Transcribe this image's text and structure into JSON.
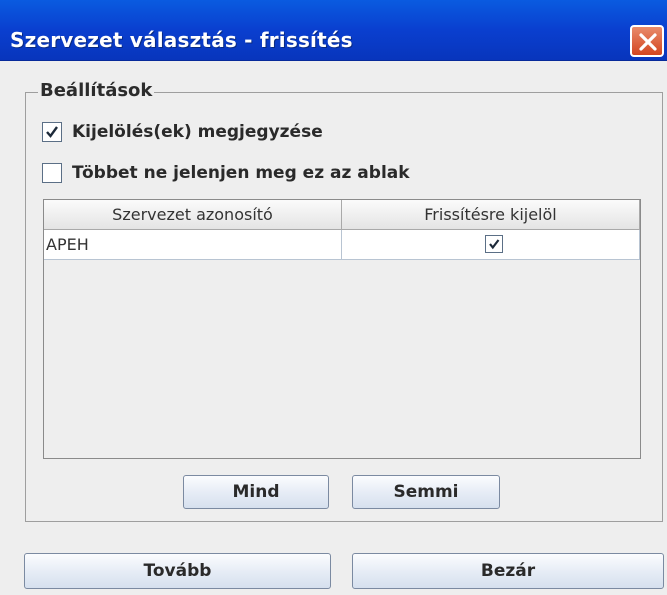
{
  "window": {
    "title": "Szervezet választás - frissítés",
    "close_icon": "close-icon",
    "title_color": "#0a3fcf",
    "close_color": "#d3451f"
  },
  "settings": {
    "legend": "Beállítások",
    "options": [
      {
        "label": "Kijelölés(ek) megjegyzése",
        "checked": true
      },
      {
        "label": "Többet ne jelenjen meg ez az ablak",
        "checked": false
      }
    ]
  },
  "table": {
    "columns": [
      "Szervezet azonosító",
      "Frissítésre kijelöl"
    ],
    "rows": [
      {
        "id": "APEH",
        "selected": true
      }
    ]
  },
  "buttons": {
    "all": "Mind",
    "none": "Semmi",
    "next": "Tovább",
    "close": "Bezár"
  }
}
